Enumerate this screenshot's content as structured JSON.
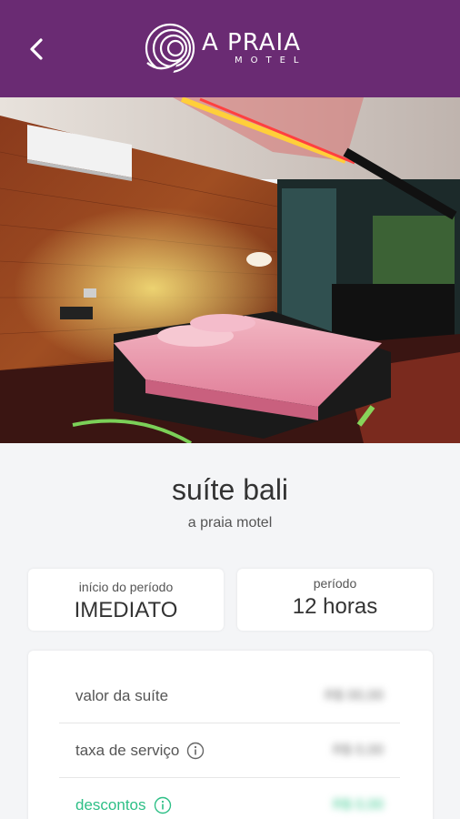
{
  "header": {
    "logo_text": "A PRAIA",
    "logo_subtext": "MOTEL",
    "background_color": "#6a2b73"
  },
  "gallery": {
    "slide_count": 12,
    "active_index": 0
  },
  "suite": {
    "name": "suíte bali",
    "motel": "a praia motel"
  },
  "info": {
    "start_label": "início do período",
    "start_value": "IMEDIATO",
    "period_label": "período",
    "period_value": "12 horas"
  },
  "pricing": {
    "rows": [
      {
        "label": "valor da suíte",
        "value": "R$ 00,00",
        "has_info": false
      },
      {
        "label": "taxa de serviço",
        "value": "R$ 0,00",
        "has_info": true
      },
      {
        "label": "descontos",
        "value": "R$ 0,00",
        "has_info": true
      }
    ],
    "discount_color": "#2dbf86"
  }
}
